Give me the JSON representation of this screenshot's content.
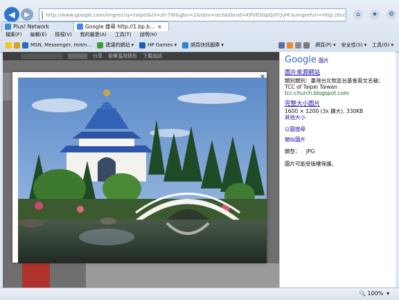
{
  "browser": {
    "url": "http://www.google.com/imgres?q=taipei&hl=zh-TW&gbv=2&tbm=isch&tbnid=KPVfOGpQzFQyM:&imgrefurl=http://tcc-church.blc",
    "tabs": [
      {
        "label": "Plus! Network",
        "active": false
      },
      {
        "label": "Google 搜尋 http://1.bp.b...",
        "active": true
      }
    ],
    "menu": [
      "檔案(F)",
      "編輯(E)",
      "檢視(V)",
      "我的最愛(A)",
      "工具(T)",
      "說明(H)"
    ],
    "favorites": [
      "MSN, Messenger, Hotm...",
      "建議的網站 ▾",
      "HP Games ▾",
      "網頁快訊圖庫 ▾"
    ],
    "commands": [
      "網頁(P) ▾",
      "安全性(S) ▾",
      "工具(O) ▾"
    ],
    "zoom": "100%"
  },
  "page": {
    "search_bar": [
      "分享",
      "檢舉濫用情形",
      "下載說話"
    ]
  },
  "side": {
    "brand": "Google",
    "brand_suffix": "圖片",
    "source_link": "圖片來源網站",
    "category_line": "類別類別：臺灣台北牧區台基會英文名稱：",
    "title_line": "TCC of Taipei Taiwan",
    "domain": "tcc-church.blogspot.com",
    "full_size_link": "完整大小圖片",
    "dimensions": "1600 × 1200 (3x 擴大), 330KB",
    "other_sizes": "其他大小",
    "search_by_image": "以圖搜尋",
    "similar_images": "類似圖片",
    "type_label": "類型：",
    "type_value": "JPG",
    "copyright": "圖片可能受版權保護。"
  },
  "colors": {
    "accent": "#1a0dab",
    "green": "#006621",
    "chrome": "#d6e1ee"
  }
}
